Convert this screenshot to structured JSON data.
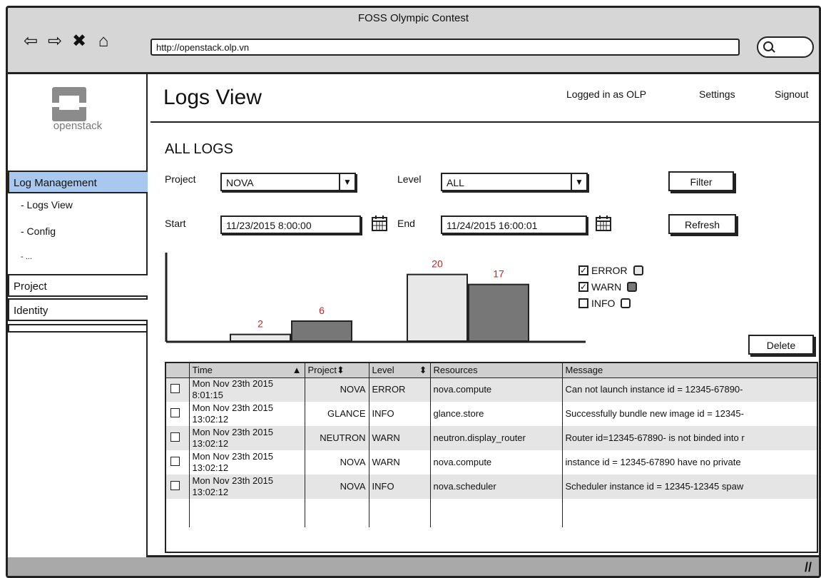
{
  "window": {
    "title": "FOSS Olympic Contest",
    "url": "http://openstack.olp.vn"
  },
  "nav_icons": [
    "back-arrow-icon",
    "forward-arrow-icon",
    "close-icon",
    "home-icon"
  ],
  "sidebar": {
    "logo_text": "openstack",
    "items": [
      {
        "label": "Log Management",
        "active": true
      },
      {
        "label": "Project",
        "active": false
      },
      {
        "label": "Identity",
        "active": false
      }
    ],
    "sub_items": [
      "- Logs View",
      "- Config",
      "- ..."
    ]
  },
  "header": {
    "title": "Logs View",
    "logged_in": "Logged in as OLP",
    "settings": "Settings",
    "signout": "Signout"
  },
  "filters": {
    "section_title": "ALL LOGS",
    "project_label": "Project",
    "project_value": "NOVA",
    "level_label": "Level",
    "level_value": "ALL",
    "start_label": "Start",
    "start_value": "11/23/2015 8:00:00",
    "end_label": "End",
    "end_value": "11/24/2015 16:00:01",
    "filter_button": "Filter",
    "refresh_button": "Refresh",
    "delete_button": "Delete"
  },
  "legend": [
    {
      "label": "ERROR",
      "checked": true,
      "color": "#e8e8e8"
    },
    {
      "label": "WARN",
      "checked": true,
      "color": "#777777"
    },
    {
      "label": "INFO",
      "checked": false,
      "color": "#ffffff"
    }
  ],
  "chart_data": {
    "type": "bar",
    "series": [
      {
        "name": "ERROR",
        "values": [
          2,
          20
        ]
      },
      {
        "name": "WARN",
        "values": [
          6,
          17
        ]
      }
    ],
    "value_color": "#cc2222",
    "ylim": [
      0,
      24
    ]
  },
  "table": {
    "columns": [
      "Time",
      "Project",
      "Level",
      "Resources",
      "Message"
    ],
    "sort_icons": [
      "sort-asc-icon",
      "sort-both-icon",
      "sort-both-icon"
    ],
    "rows": [
      {
        "time": "Mon Nov 23th 2015 8:01:15",
        "project": "NOVA",
        "level": "ERROR",
        "resource": "nova.compute",
        "message": "Can not launch instance id = 12345-67890-"
      },
      {
        "time": "Mon Nov 23th 2015 13:02:12",
        "project": "GLANCE",
        "level": "INFO",
        "resource": "glance.store",
        "message": "Successfully bundle new image id = 12345-"
      },
      {
        "time": "Mon Nov 23th 2015 13:02:12",
        "project": "NEUTRON",
        "level": "WARN",
        "resource": "neutron.display_router",
        "message": "Router id=12345-67890- is not binded into r"
      },
      {
        "time": "Mon Nov 23th 2015 13:02:12",
        "project": "NOVA",
        "level": "WARN",
        "resource": "nova.compute",
        "message": "instance id = 12345-67890 have no private"
      },
      {
        "time": "Mon Nov 23th 2015 13:02:12",
        "project": "NOVA",
        "level": "INFO",
        "resource": "nova.scheduler",
        "message": "Scheduler instance id = 12345-12345 spaw"
      }
    ]
  }
}
